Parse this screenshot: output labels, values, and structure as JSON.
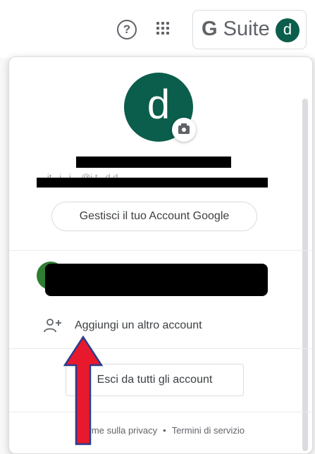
{
  "header": {
    "help_icon": "?",
    "brand_g": "G",
    "brand_suite": "Suite",
    "avatar_letter": "d"
  },
  "profile": {
    "avatar_letter": "d",
    "email_partial": "...it...i...i....@i.t...d.d...",
    "manage_button": "Gestisci il tuo Account Google"
  },
  "accounts": {
    "add_account_label": "Aggiungi un altro account",
    "signout_all_label": "Esci da tutti gli account"
  },
  "footer": {
    "privacy": "Norme sulla privacy",
    "separator": "•",
    "terms": "Termini di servizio"
  },
  "colors": {
    "avatar_bg": "#0b5e4b",
    "annotation_arrow": "#e8192c",
    "annotation_outline": "#2a3b8f"
  },
  "icons": {
    "help": "help-circle-icon",
    "apps": "apps-grid-icon",
    "camera": "camera-icon",
    "add_person": "person-add-icon"
  }
}
